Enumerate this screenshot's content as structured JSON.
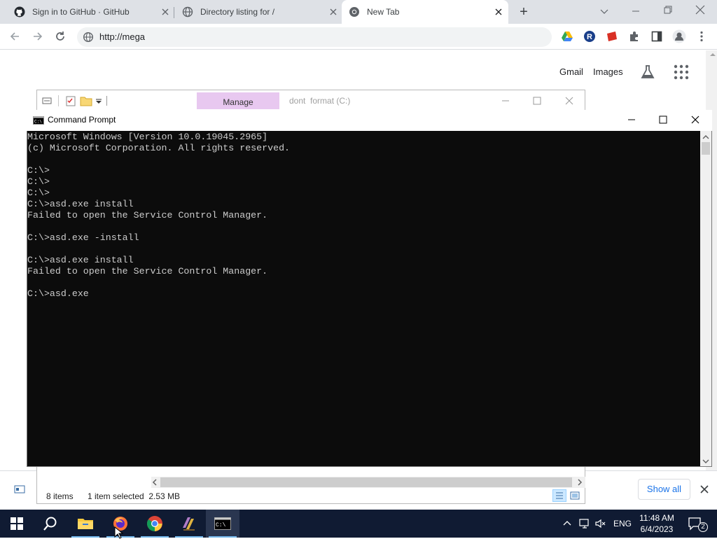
{
  "browser": {
    "tabs": [
      {
        "title": "Sign in to GitHub · GitHub",
        "icon": "github-icon"
      },
      {
        "title": "Directory listing for /",
        "icon": "globe-icon"
      },
      {
        "title": "New Tab",
        "icon": "chrome-icon",
        "active": true
      }
    ],
    "new_tab_label": "+",
    "url": "http://mega",
    "toolbar_icons": [
      "google-drive-icon",
      "r-extension-icon",
      "red-extension-icon",
      "extensions-puzzle-icon",
      "side-panel-icon",
      "profile-icon",
      "menu-kebab-icon"
    ]
  },
  "google": {
    "gmail_link": "Gmail",
    "images_link": "Images"
  },
  "explorer": {
    "manage_tab": "Manage",
    "title": "dont  format (C:)",
    "status_items": "8 items",
    "status_selected": "1 item selected  2.53 MB"
  },
  "download_bar": {
    "show_all": "Show all"
  },
  "cmd": {
    "title": "Command Prompt",
    "lines": "Microsoft Windows [Version 10.0.19045.2965]\n(c) Microsoft Corporation. All rights reserved.\n\nC:\\>\nC:\\>\nC:\\>\nC:\\>asd.exe install\nFailed to open the Service Control Manager.\n\nC:\\>asd.exe -install\n\nC:\\>asd.exe install\nFailed to open the Service Control Manager.\n\nC:\\>asd.exe"
  },
  "taskbar": {
    "language": "ENG",
    "time": "11:48 AM",
    "date": "6/4/2023",
    "notification_count": "2",
    "colors": {
      "background": "#101b33",
      "accent": "#76b9ed"
    }
  }
}
